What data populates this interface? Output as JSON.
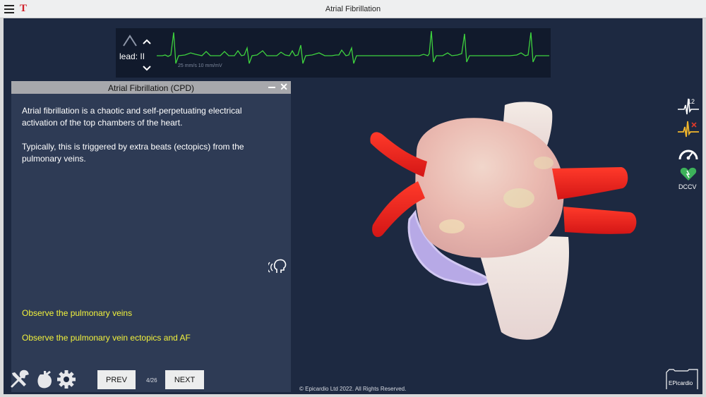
{
  "app": {
    "title": "Atrial Fibrillation",
    "logo": "T"
  },
  "ecg": {
    "lead_label": "lead: II",
    "scale": "25 mm/s  10 mm/mV",
    "trace_color": "#3ed23e"
  },
  "panel": {
    "title": "Atrial Fibrillation (CPD)",
    "paragraphs": [
      "Atrial fibrillation is a chaotic and self-perpetuating electrical activation of the top chambers of the heart.",
      "Typically, this is triggered by extra beats (ectopics) from the pulmonary veins."
    ],
    "links": [
      "Observe the pulmonary veins",
      "Observe the pulmonary vein ectopics and AF"
    ]
  },
  "nav": {
    "prev": "PREV",
    "next": "NEXT",
    "page": "4/26"
  },
  "sidebar": {
    "dccv": "DCCV",
    "twelve_lead": "12"
  },
  "footer": {
    "copyright": "© Epicardio Ltd 2022. All Rights Reserved.",
    "brand": "EPicardio"
  },
  "colors": {
    "background": "#1d2941",
    "panel": "#2e3b55",
    "link": "#f2f23c",
    "vein": "#e52222"
  }
}
